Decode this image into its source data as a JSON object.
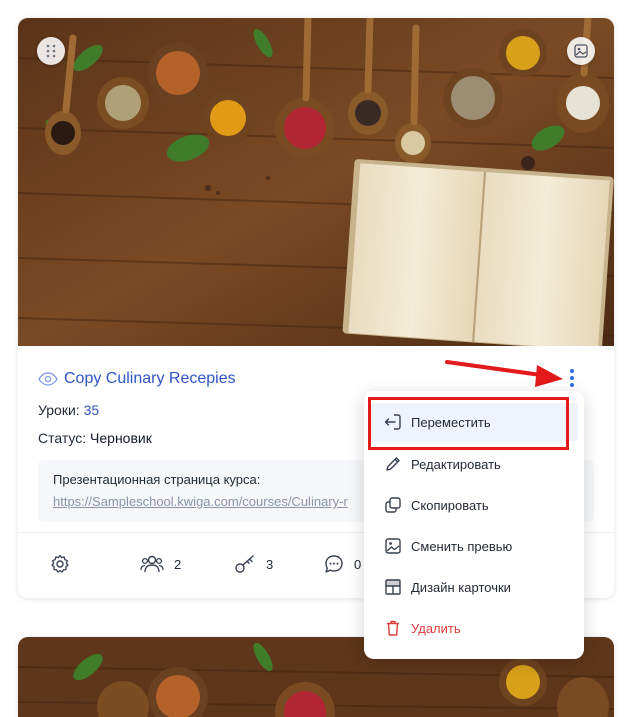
{
  "course": {
    "title": "Copy Culinary Recepies",
    "lessons_label": "Уроки:",
    "lessons_value": "35",
    "status_label": "Статус:",
    "status_value": "Черновик",
    "presentation_label": "Презентационная страница курса:",
    "presentation_url": "https://Sampleschool.kwiga.com/courses/Culinary-r"
  },
  "stats": {
    "students": "2",
    "keys": "3",
    "comments": "0"
  },
  "menu": {
    "items": [
      {
        "label": "Переместить",
        "icon": "move-icon"
      },
      {
        "label": "Редактировать",
        "icon": "pencil-icon"
      },
      {
        "label": "Скопировать",
        "icon": "copy-icon"
      },
      {
        "label": "Сменить превью",
        "icon": "image-icon"
      },
      {
        "label": "Дизайн карточки",
        "icon": "layout-icon"
      },
      {
        "label": "Удалить",
        "icon": "trash-icon"
      }
    ]
  },
  "colors": {
    "accent": "#2f55c6",
    "danger": "#e23b3b",
    "annotation": "#e3191b"
  }
}
